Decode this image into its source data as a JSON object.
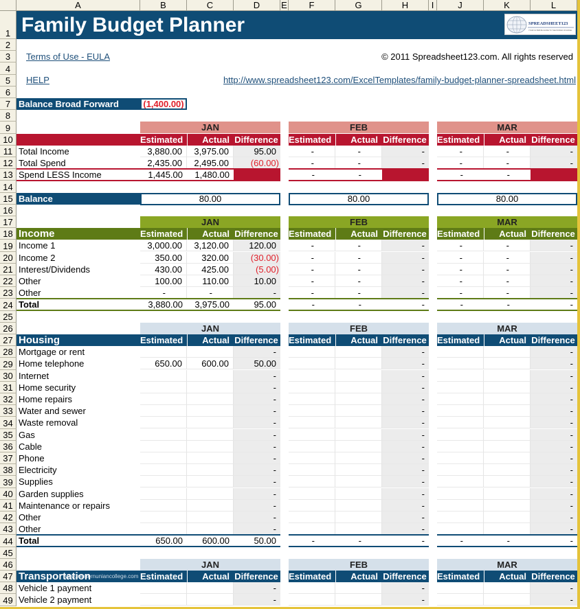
{
  "columns": [
    "A",
    "B",
    "C",
    "D",
    "E",
    "F",
    "G",
    "H",
    "I",
    "J",
    "K",
    "L"
  ],
  "header": {
    "title": "Family Budget Planner",
    "logo_text": "SPREADSHEET123",
    "logo_tagline": "YOUR ULTIMATE GUIDE TO THE WORLD OF EXCEL",
    "terms_link": "Terms of Use - EULA",
    "help_link": "HELP",
    "copyright": "© 2011 Spreadsheet123.com. All rights reserved",
    "url_link": "http://www.spreadsheet123.com/ExcelTemplates/family-budget-planner-spreadsheet.html"
  },
  "balance_forward": {
    "label": "Balance Broad Forward",
    "value": "(1,400.00)"
  },
  "months": [
    "JAN",
    "FEB",
    "MAR"
  ],
  "col_labels": {
    "estimated": "Estimated",
    "actual": "Actual",
    "difference": "Difference"
  },
  "summary": {
    "rows": [
      {
        "label": "Total Income",
        "values": [
          [
            "3,880.00",
            "3,975.00",
            "95.00"
          ],
          [
            "-",
            "-",
            "-"
          ],
          [
            "-",
            "-",
            "-"
          ]
        ]
      },
      {
        "label": "Total Spend",
        "values": [
          [
            "2,435.00",
            "2,495.00",
            "(60.00)"
          ],
          [
            "-",
            "-",
            "-"
          ],
          [
            "-",
            "-",
            "-"
          ]
        ]
      },
      {
        "label": "Spend LESS Income",
        "values": [
          [
            "1,445.00",
            "1,480.00",
            ""
          ],
          [
            "-",
            "-",
            ""
          ],
          [
            "-",
            "-",
            ""
          ]
        ]
      }
    ],
    "balance_label": "Balance",
    "balance_values": [
      "80.00",
      "80.00",
      "80.00"
    ]
  },
  "income": {
    "title": "Income",
    "rows": [
      {
        "label": "Income 1",
        "values": [
          [
            "3,000.00",
            "3,120.00",
            "120.00"
          ],
          [
            "-",
            "-",
            "-"
          ],
          [
            "-",
            "-",
            "-"
          ]
        ]
      },
      {
        "label": "Income 2",
        "values": [
          [
            "350.00",
            "320.00",
            "(30.00)"
          ],
          [
            "-",
            "-",
            "-"
          ],
          [
            "-",
            "-",
            "-"
          ]
        ]
      },
      {
        "label": "Interest/Dividends",
        "values": [
          [
            "430.00",
            "425.00",
            "(5.00)"
          ],
          [
            "-",
            "-",
            "-"
          ],
          [
            "-",
            "-",
            "-"
          ]
        ]
      },
      {
        "label": "Other",
        "values": [
          [
            "100.00",
            "110.00",
            "10.00"
          ],
          [
            "-",
            "-",
            "-"
          ],
          [
            "-",
            "-",
            "-"
          ]
        ]
      },
      {
        "label": "Other",
        "values": [
          [
            "-",
            "-",
            "-"
          ],
          [
            "-",
            "-",
            "-"
          ],
          [
            "-",
            "-",
            "-"
          ]
        ]
      }
    ],
    "total": {
      "label": "Total",
      "values": [
        [
          "3,880.00",
          "3,975.00",
          "95.00"
        ],
        [
          "-",
          "-",
          "-"
        ],
        [
          "-",
          "-",
          "-"
        ]
      ]
    }
  },
  "housing": {
    "title": "Housing",
    "rows": [
      {
        "label": "Mortgage or rent",
        "values": [
          [
            "",
            "",
            "-"
          ],
          [
            "",
            "",
            "-"
          ],
          [
            "",
            "",
            "-"
          ]
        ]
      },
      {
        "label": "Home telephone",
        "values": [
          [
            "650.00",
            "600.00",
            "50.00"
          ],
          [
            "",
            "",
            "-"
          ],
          [
            "",
            "",
            "-"
          ]
        ]
      },
      {
        "label": "Internet",
        "values": [
          [
            "",
            "",
            "-"
          ],
          [
            "",
            "",
            "-"
          ],
          [
            "",
            "",
            "-"
          ]
        ]
      },
      {
        "label": "Home security",
        "values": [
          [
            "",
            "",
            "-"
          ],
          [
            "",
            "",
            "-"
          ],
          [
            "",
            "",
            "-"
          ]
        ]
      },
      {
        "label": "Home repairs",
        "values": [
          [
            "",
            "",
            "-"
          ],
          [
            "",
            "",
            "-"
          ],
          [
            "",
            "",
            "-"
          ]
        ]
      },
      {
        "label": "Water and sewer",
        "values": [
          [
            "",
            "",
            "-"
          ],
          [
            "",
            "",
            "-"
          ],
          [
            "",
            "",
            "-"
          ]
        ]
      },
      {
        "label": "Waste removal",
        "values": [
          [
            "",
            "",
            "-"
          ],
          [
            "",
            "",
            "-"
          ],
          [
            "",
            "",
            "-"
          ]
        ]
      },
      {
        "label": "Gas",
        "values": [
          [
            "",
            "",
            "-"
          ],
          [
            "",
            "",
            "-"
          ],
          [
            "",
            "",
            "-"
          ]
        ]
      },
      {
        "label": "Cable",
        "values": [
          [
            "",
            "",
            "-"
          ],
          [
            "",
            "",
            "-"
          ],
          [
            "",
            "",
            "-"
          ]
        ]
      },
      {
        "label": "Phone",
        "values": [
          [
            "",
            "",
            "-"
          ],
          [
            "",
            "",
            "-"
          ],
          [
            "",
            "",
            "-"
          ]
        ]
      },
      {
        "label": "Electricity",
        "values": [
          [
            "",
            "",
            "-"
          ],
          [
            "",
            "",
            "-"
          ],
          [
            "",
            "",
            "-"
          ]
        ]
      },
      {
        "label": "Supplies",
        "values": [
          [
            "",
            "",
            "-"
          ],
          [
            "",
            "",
            "-"
          ],
          [
            "",
            "",
            "-"
          ]
        ]
      },
      {
        "label": "Garden supplies",
        "values": [
          [
            "",
            "",
            "-"
          ],
          [
            "",
            "",
            "-"
          ],
          [
            "",
            "",
            "-"
          ]
        ]
      },
      {
        "label": "Maintenance or repairs",
        "values": [
          [
            "",
            "",
            "-"
          ],
          [
            "",
            "",
            "-"
          ],
          [
            "",
            "",
            "-"
          ]
        ]
      },
      {
        "label": "Other",
        "values": [
          [
            "",
            "",
            "-"
          ],
          [
            "",
            "",
            "-"
          ],
          [
            "",
            "",
            "-"
          ]
        ]
      },
      {
        "label": "Other",
        "values": [
          [
            "",
            "",
            "-"
          ],
          [
            "",
            "",
            "-"
          ],
          [
            "",
            "",
            "-"
          ]
        ]
      }
    ],
    "total": {
      "label": "Total",
      "values": [
        [
          "650.00",
          "600.00",
          "50.00"
        ],
        [
          "-",
          "-",
          "-"
        ],
        [
          "-",
          "-",
          "-"
        ]
      ]
    }
  },
  "transportation": {
    "title": "Transportation",
    "watermark": "www.westernuniancollege.com",
    "rows": [
      {
        "label": "Vehicle 1 payment",
        "values": [
          [
            "",
            "",
            "-"
          ],
          [
            "",
            "",
            "-"
          ],
          [
            "",
            "",
            "-"
          ]
        ]
      },
      {
        "label": "Vehicle 2 payment",
        "values": [
          [
            "",
            "",
            "-"
          ],
          [
            "",
            "",
            "-"
          ],
          [
            "",
            "",
            "-"
          ]
        ]
      }
    ]
  },
  "colors": {
    "navy": "#0f4c75",
    "red": "#b8152f",
    "salmon": "#e0928a",
    "green_dark": "#5e7b16",
    "green_light": "#8aa624",
    "blue_light": "#d5e0ea",
    "diff_gray": "#ececec",
    "negative": "#e0202a",
    "frame": "#e5c33a"
  }
}
